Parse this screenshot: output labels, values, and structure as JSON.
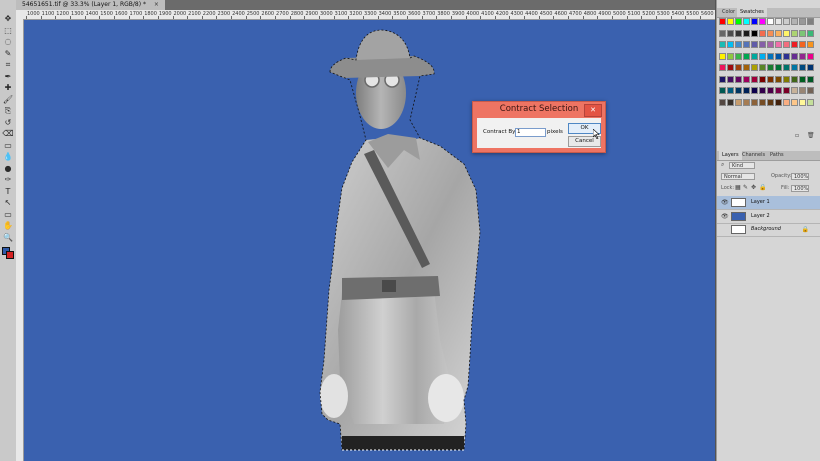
{
  "document": {
    "tab_title": "54651651.tif @ 33.3% (Layer 1, RGB/8) *",
    "tab_close": "×"
  },
  "ruler": {
    "top_labels": [
      "1000",
      "1100",
      "1200",
      "1300",
      "1400",
      "1500",
      "1600",
      "1700",
      "1800",
      "1900",
      "2000",
      "2100",
      "2200",
      "2300",
      "2400",
      "2500",
      "2600",
      "2700",
      "2800",
      "2900",
      "3000",
      "3100",
      "3200",
      "3300",
      "3400",
      "3500",
      "3600",
      "3700",
      "3800",
      "3900",
      "4000",
      "4100",
      "4200",
      "4300",
      "4400",
      "4500",
      "4600",
      "4700",
      "4800",
      "4900",
      "5000",
      "5100",
      "5200",
      "5300",
      "5400",
      "5500",
      "5600"
    ]
  },
  "tools": {
    "icons": [
      "move-tool-icon",
      "rect-marquee-icon",
      "lasso-icon",
      "quick-select-icon",
      "crop-icon",
      "eyedropper-icon",
      "healing-brush-icon",
      "brush-icon",
      "clone-stamp-icon",
      "history-brush-icon",
      "eraser-icon",
      "gradient-icon",
      "blur-icon",
      "dodge-icon",
      "pen-icon",
      "type-icon",
      "path-select-icon",
      "shape-icon",
      "hand-icon",
      "zoom-icon"
    ],
    "glyphs": [
      "✥",
      "⬚",
      "◌",
      "✎",
      "⌗",
      "✒",
      "✚",
      "🖌",
      "⎘",
      "↺",
      "⌫",
      "▭",
      "💧",
      "●",
      "✑",
      "T",
      "↖",
      "▭",
      "✋",
      "🔍"
    ],
    "foreground_color": "#2f5aa8",
    "background_color": "#d42222"
  },
  "canvas": {
    "background_color": "#3a61af"
  },
  "dialog": {
    "title": "Contract Selection",
    "close_glyph": "✕",
    "contract_label": "Contract By:",
    "contract_value": "1",
    "units_label": "pixels",
    "ok_label": "OK",
    "cancel_label": "Cancel"
  },
  "swatches_panel": {
    "tabs": [
      "Color",
      "Swatches"
    ],
    "active_tab": "Swatches",
    "colors": [
      "#ff0000",
      "#ffff00",
      "#00ff00",
      "#00ffff",
      "#0000ff",
      "#ff00ff",
      "#ffffff",
      "#e6e6e6",
      "#cccccc",
      "#b3b3b3",
      "#999999",
      "#808080",
      "#666666",
      "#4d4d4d",
      "#333333",
      "#1a1a1a",
      "#000000",
      "#f26c4f",
      "#f68e55",
      "#fbaf5c",
      "#fff467",
      "#acd372",
      "#7cc576",
      "#3bb878",
      "#1abbb4",
      "#00bff3",
      "#438ccb",
      "#5574b9",
      "#605ca8",
      "#855fa8",
      "#a763a8",
      "#f06ea9",
      "#f26d7d",
      "#ed1c24",
      "#f26522",
      "#f7941d",
      "#fff200",
      "#8dc63f",
      "#39b54a",
      "#00a651",
      "#00a99d",
      "#00aeef",
      "#0072bc",
      "#0054a6",
      "#2e3192",
      "#662d91",
      "#92278f",
      "#ec008c",
      "#ed145b",
      "#9e0b0f",
      "#a0410d",
      "#a36209",
      "#aba000",
      "#598527",
      "#1a7b30",
      "#007236",
      "#00746b",
      "#0076a3",
      "#004b80",
      "#003471",
      "#1b1464",
      "#440e62",
      "#630460",
      "#9e005d",
      "#9e0039",
      "#790000",
      "#7b2e00",
      "#7d4900",
      "#827b00",
      "#406618",
      "#005e20",
      "#005826",
      "#005952",
      "#005b7f",
      "#003663",
      "#002157",
      "#0d004c",
      "#32004b",
      "#4b0049",
      "#7b0046",
      "#7a0026",
      "#c7b299",
      "#998675",
      "#736357",
      "#534741",
      "#37302a",
      "#c69c6d",
      "#a67c52",
      "#8c6239",
      "#754c24",
      "#603913",
      "#42210b",
      "#f9ad81",
      "#fdc689",
      "#fff799",
      "#c4df9b"
    ]
  },
  "layers_panel": {
    "tabs": [
      "Layers",
      "Channels",
      "Paths"
    ],
    "active_tab": "Layers",
    "kind_label": "Kind",
    "blend_mode": "Normal",
    "opacity_label": "Opacity:",
    "opacity_value": "100%",
    "lock_label": "Lock:",
    "fill_label": "Fill:",
    "fill_value": "100%",
    "layers": [
      {
        "name": "Layer 1",
        "selected": true,
        "visible": true,
        "italic": false
      },
      {
        "name": "Layer 2",
        "selected": false,
        "visible": true,
        "italic": false
      },
      {
        "name": "Background",
        "selected": false,
        "visible": false,
        "italic": true
      }
    ]
  }
}
